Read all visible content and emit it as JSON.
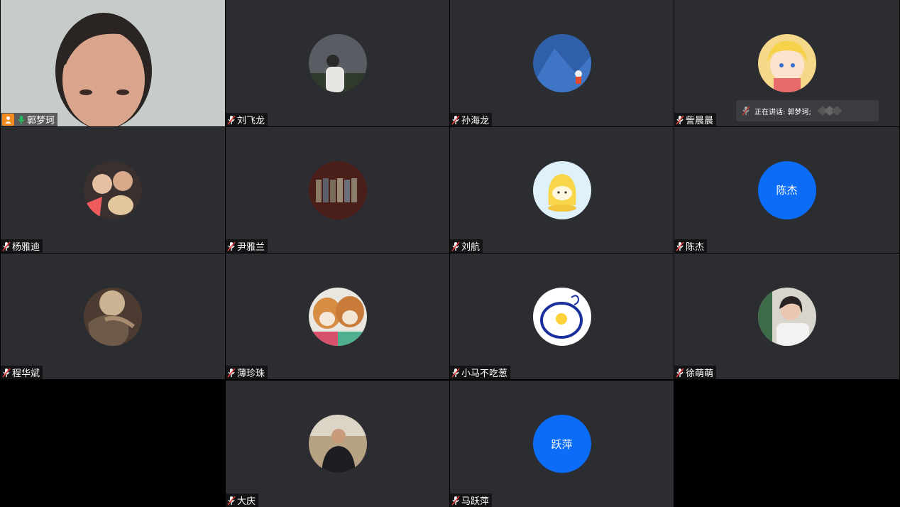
{
  "participants": [
    {
      "name": "郭梦珂",
      "avatar": "camera-video",
      "is_self": true,
      "host": true,
      "mic": "active"
    },
    {
      "name": "刘飞龙",
      "avatar": "photo-person-on-hill",
      "mic": "muted"
    },
    {
      "name": "孙海龙",
      "avatar": "photo-astronaut-blue",
      "mic": "muted"
    },
    {
      "name": "訾晨晨",
      "avatar": "photo-cartoon-girl",
      "mic": "muted"
    },
    {
      "name": "杨雅迪",
      "avatar": "photo-couple-dog",
      "mic": "muted"
    },
    {
      "name": "尹雅兰",
      "avatar": "photo-group",
      "mic": "muted"
    },
    {
      "name": "刘航",
      "avatar": "photo-yellow-cartoon",
      "mic": "muted"
    },
    {
      "name": "陈杰",
      "avatar_text": "陈杰",
      "mic": "muted"
    },
    {
      "name": "程华斌",
      "avatar": "photo-dark-object",
      "mic": "muted"
    },
    {
      "name": "薄珍珠",
      "avatar": "photo-shiba-dogs",
      "mic": "muted"
    },
    {
      "name": "小马不吃葱",
      "avatar": "photo-blue-circle-chick",
      "mic": "muted"
    },
    {
      "name": "徐萌萌",
      "avatar": "photo-girl-reading",
      "mic": "muted"
    },
    {
      "name": "大庆",
      "avatar": "photo-man-outdoors",
      "mic": "muted"
    },
    {
      "name": "马跃萍",
      "avatar_text": "跃萍",
      "mic": "muted"
    }
  ],
  "speaking_indicator": {
    "label": "正在讲话: 郭梦珂;"
  },
  "colors": {
    "tile_bg": "#2b2d31",
    "text_avatar": "#0b6cf7",
    "host_badge": "#f58a1f",
    "active_mic": "#1fbf62"
  }
}
